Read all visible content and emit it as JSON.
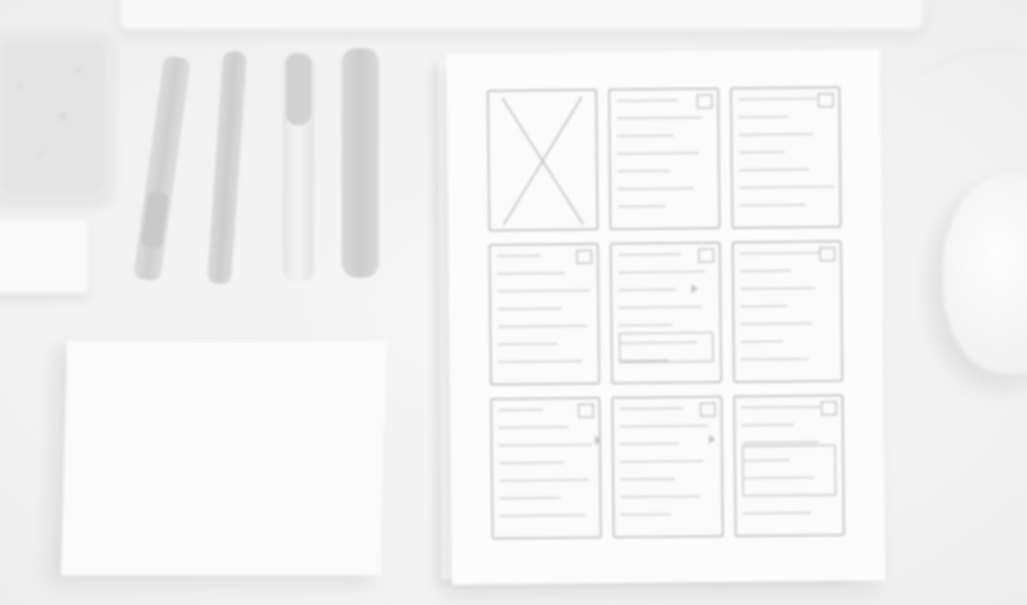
{
  "scene": {
    "type": "photo",
    "objects": [
      {
        "name": "keyboard"
      },
      {
        "name": "stone-tray"
      },
      {
        "name": "eraser"
      },
      {
        "name": "pen"
      },
      {
        "name": "pencil"
      },
      {
        "name": "marker"
      },
      {
        "name": "stylus"
      },
      {
        "name": "blank-notepad"
      },
      {
        "name": "wireframe-sketch-sheet",
        "frames": 9
      },
      {
        "name": "mouse"
      }
    ]
  },
  "colors": {
    "background": "#f1f1f1",
    "paper": "#fcfcfc",
    "sketch_ink": "#b8b8b8"
  }
}
